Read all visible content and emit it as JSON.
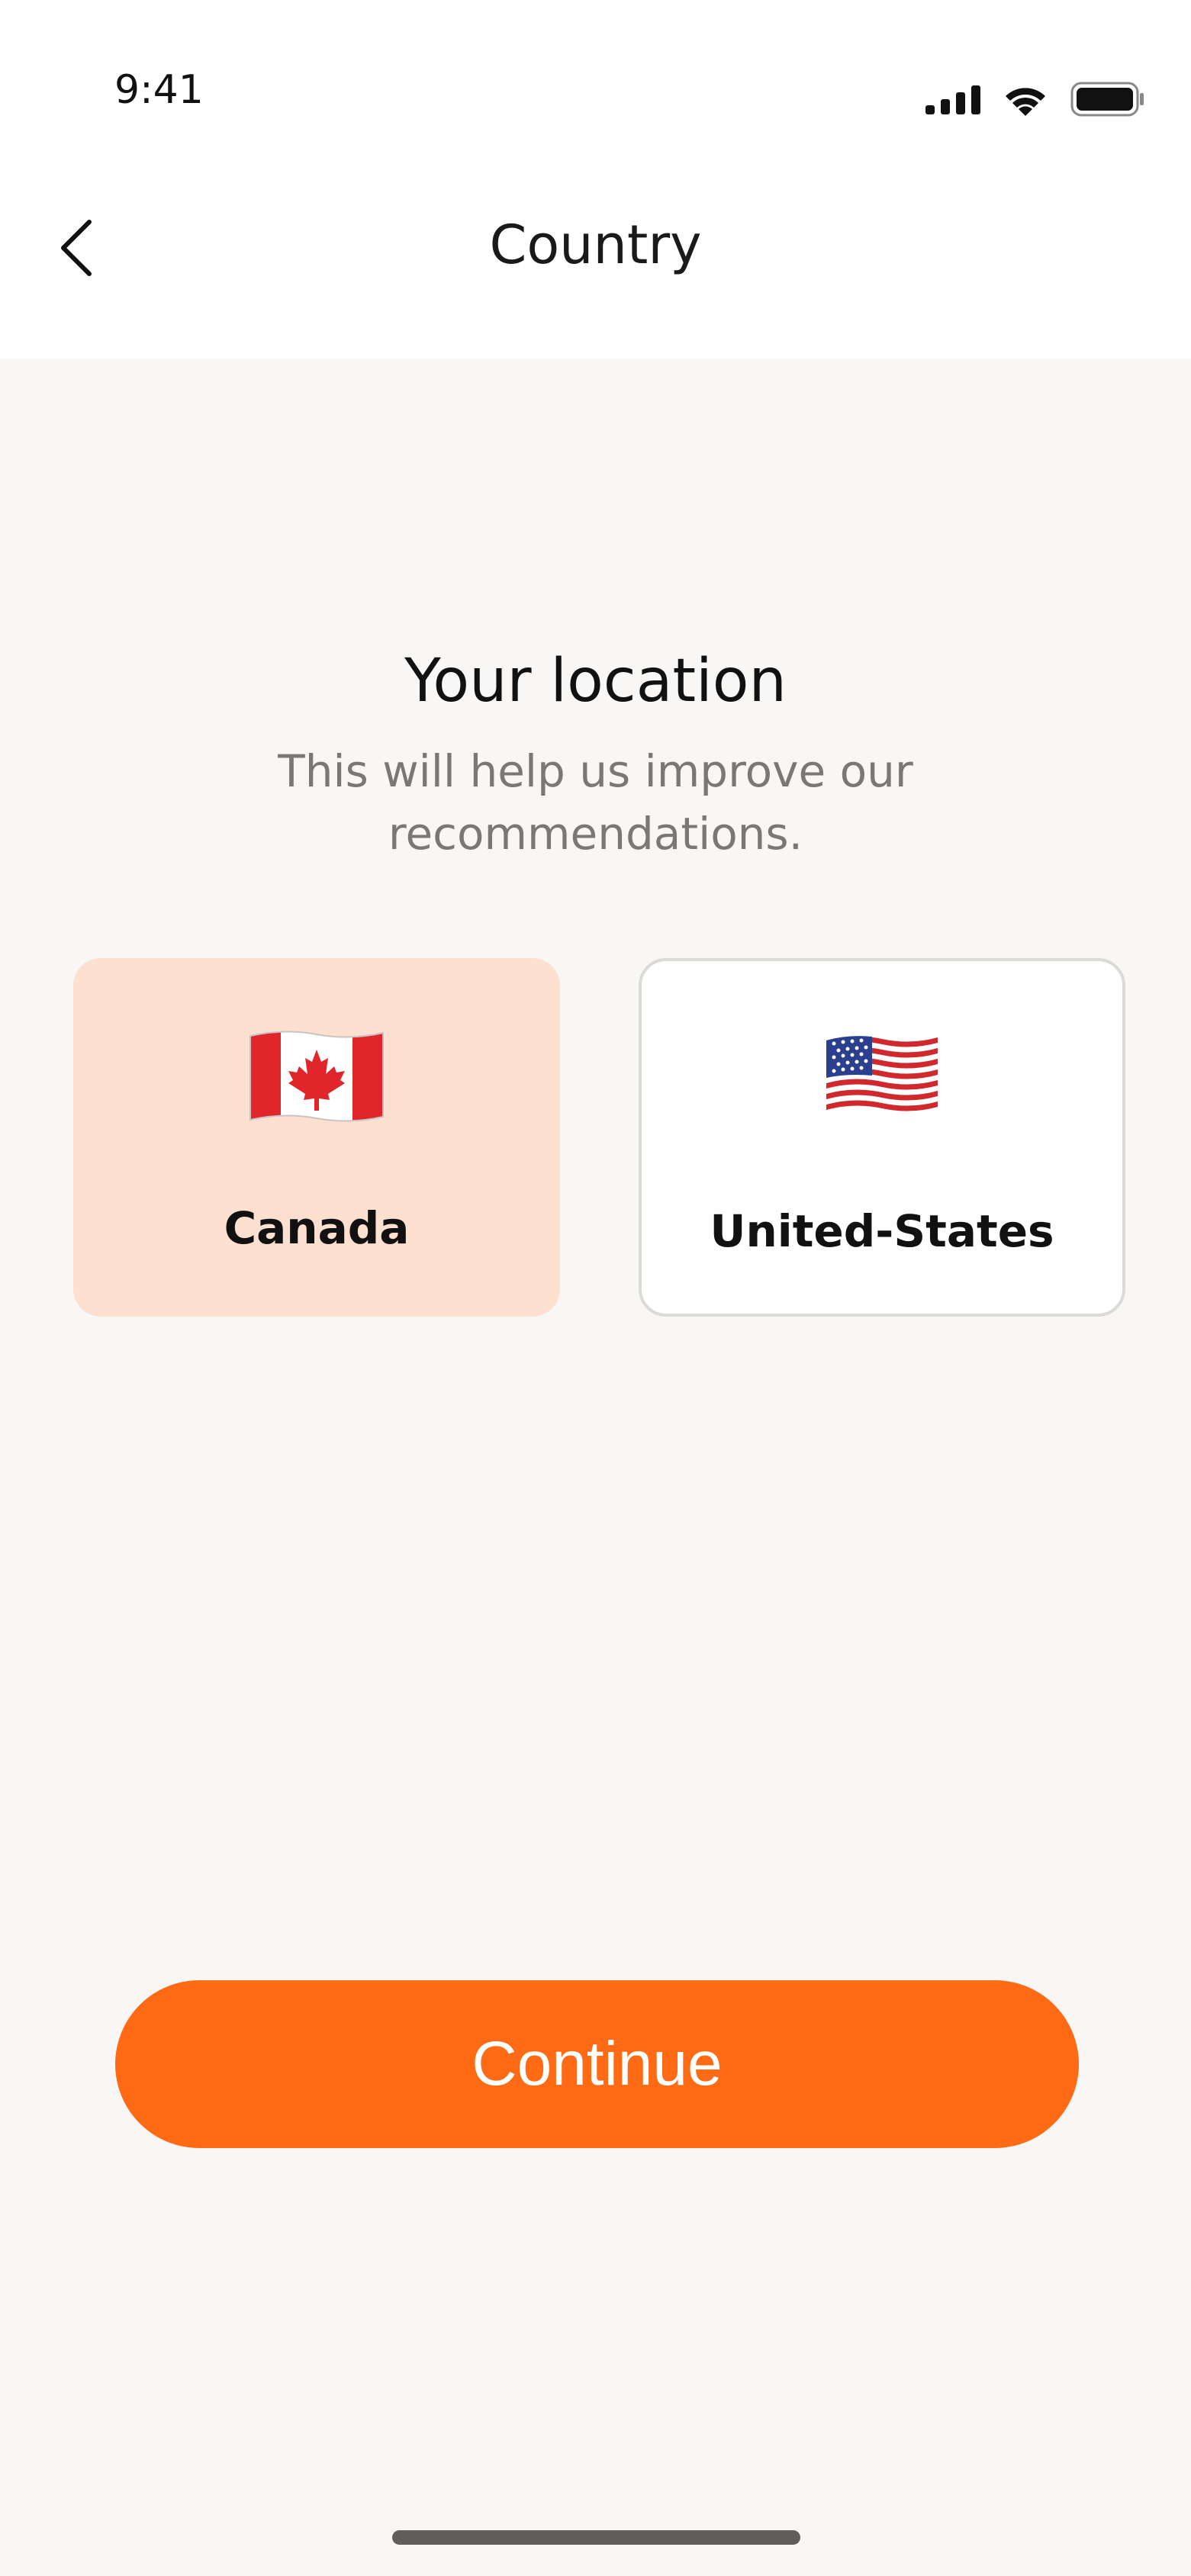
{
  "status_bar": {
    "time": "9:41"
  },
  "nav": {
    "title": "Country",
    "back_icon": "chevron-left-icon"
  },
  "main": {
    "heading": "Your location",
    "subheading": "This will help us improve our recommendations.",
    "countries": [
      {
        "label": "Canada",
        "flag_icon": "canada-flag-icon",
        "selected": true
      },
      {
        "label": "United-States",
        "flag_icon": "us-flag-icon",
        "selected": false
      }
    ]
  },
  "footer": {
    "continue_label": "Continue"
  },
  "colors": {
    "accent": "#fe6b14",
    "selected_card": "#fee0d0",
    "background": "#f8f7f5",
    "muted_text": "#7b7873"
  }
}
